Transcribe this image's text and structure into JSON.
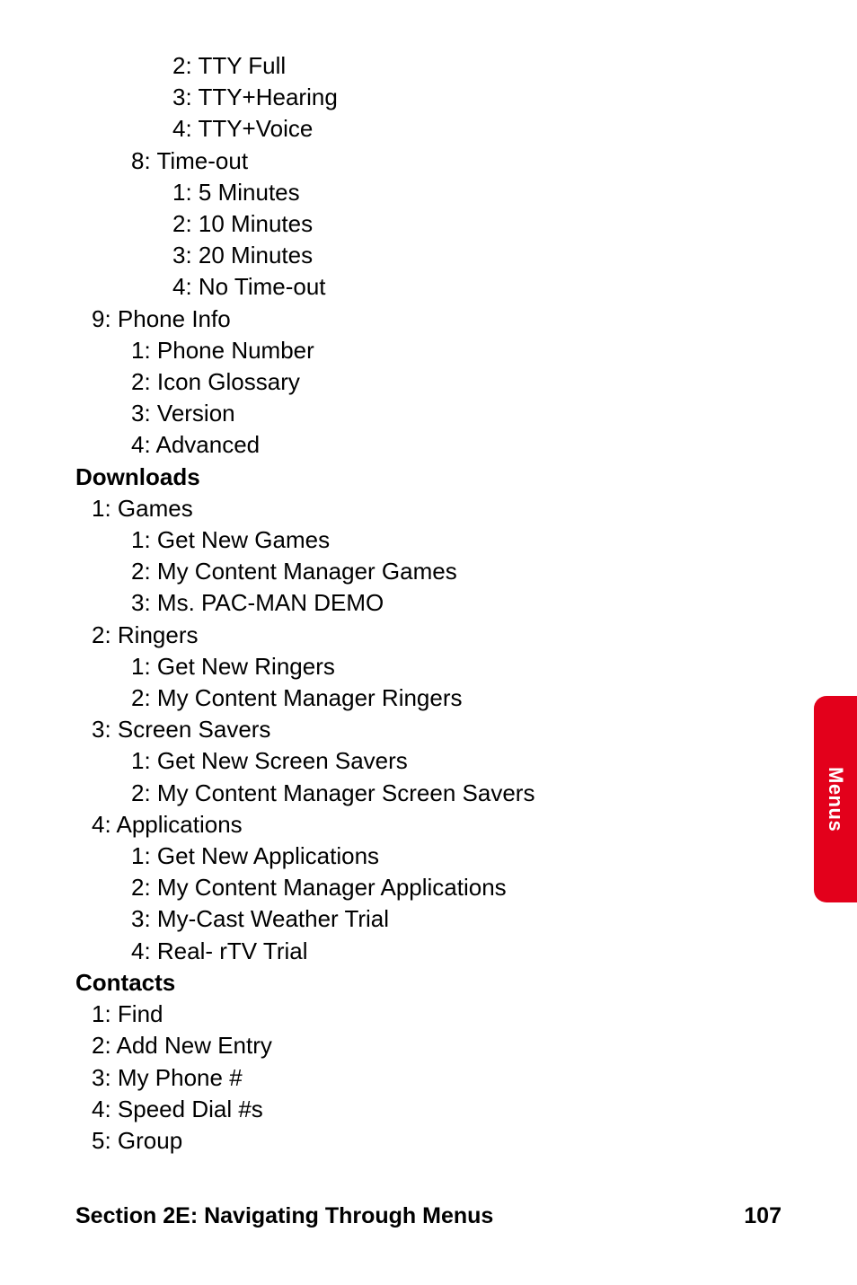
{
  "lines": {
    "l0": "2: TTY Full",
    "l1": "3: TTY+Hearing",
    "l2": "4: TTY+Voice",
    "l3": "8: Time-out",
    "l4": "1: 5 Minutes",
    "l5": "2: 10 Minutes",
    "l6": "3: 20 Minutes",
    "l7": "4: No Time-out",
    "l8": "9: Phone Info",
    "l9": "1: Phone Number",
    "l10": "2: Icon Glossary",
    "l11": "3: Version",
    "l12": "4: Advanced",
    "l13": "Downloads",
    "l14": "1: Games",
    "l15": "1: Get New Games",
    "l16": "2: My Content Manager Games",
    "l17": "3: Ms. PAC-MAN DEMO",
    "l18": "2: Ringers",
    "l19": "1: Get New Ringers",
    "l20": "2: My Content Manager Ringers",
    "l21": "3: Screen Savers",
    "l22": "1: Get New  Screen Savers",
    "l23": "2: My Content Manager Screen Savers",
    "l24": "4: Applications",
    "l25": "1: Get New Applications",
    "l26": "2: My Content Manager Applications",
    "l27": "3: My-Cast Weather Trial",
    "l28": "4: Real- rTV Trial",
    "l29": "Contacts",
    "l30": "1: Find",
    "l31": "2: Add New Entry",
    "l32": "3: My Phone #",
    "l33": "4: Speed Dial #s",
    "l34": "5: Group"
  },
  "sideTab": {
    "label": "Menus"
  },
  "footer": {
    "section": "Section 2E: Navigating Through Menus",
    "page": "107"
  }
}
